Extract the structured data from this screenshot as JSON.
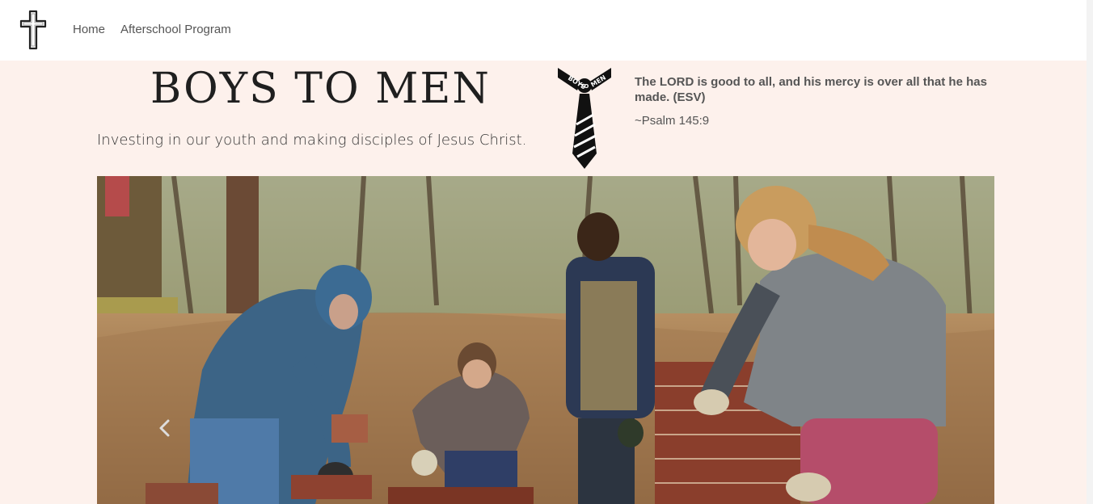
{
  "nav": {
    "logo_icon": "cross-icon",
    "links": [
      {
        "label": "Home"
      },
      {
        "label": "Afterschool Program"
      }
    ]
  },
  "header": {
    "title": "BOYS TO MEN",
    "tagline": "Investing in our youth and making disciples of Jesus Christ.",
    "logo_icon": "necktie-icon",
    "logo_text": {
      "left": "BOYS",
      "middle": "TO",
      "right": "MEN"
    }
  },
  "verse": {
    "text": "The LORD is good to all, and his mercy is over all that he has made. (ESV)",
    "reference": "~Psalm 145:9"
  },
  "carousel": {
    "prev_icon": "chevron-left-icon"
  },
  "colors": {
    "page_background": "#fdf1ec",
    "nav_background": "#ffffff",
    "title_color": "#1f1f1f",
    "text_muted": "#555555"
  }
}
